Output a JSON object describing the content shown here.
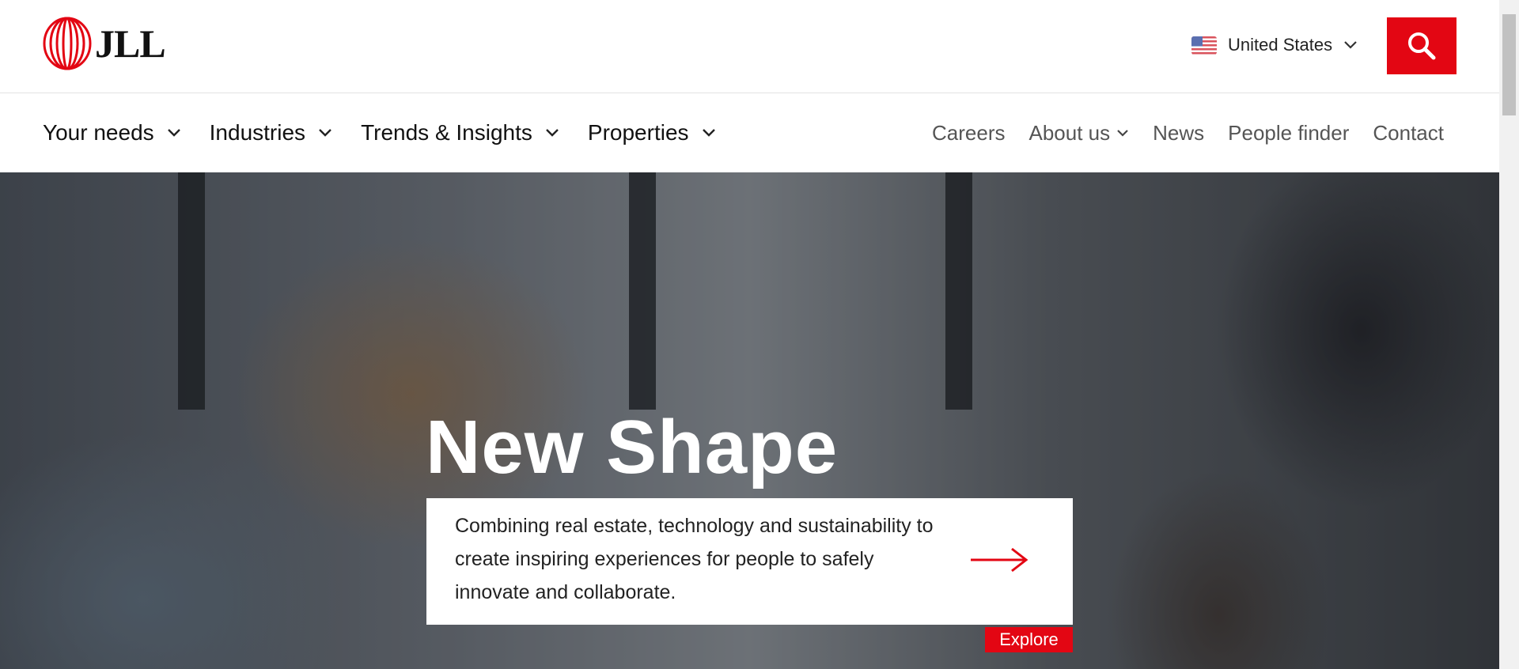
{
  "header": {
    "logo_text": "JLL",
    "country": {
      "label": "United States",
      "flag": "us-flag-icon"
    },
    "search_icon": "search-icon",
    "accent_color": "#e30613"
  },
  "nav": {
    "main": [
      {
        "label": "Your needs",
        "has_dropdown": true
      },
      {
        "label": "Industries",
        "has_dropdown": true
      },
      {
        "label": "Trends & Insights",
        "has_dropdown": true
      },
      {
        "label": "Properties",
        "has_dropdown": true
      }
    ],
    "secondary": [
      {
        "label": "Careers"
      },
      {
        "label": "About us",
        "has_dropdown": true
      },
      {
        "label": "News"
      },
      {
        "label": "People finder"
      },
      {
        "label": "Contact"
      }
    ]
  },
  "hero": {
    "title": "New Shape",
    "description": "Combining real estate, technology and sustainability to create inspiring experiences for people to safely innovate and collaborate.",
    "cta_icon": "arrow-right-icon",
    "explore_label": "Explore"
  }
}
